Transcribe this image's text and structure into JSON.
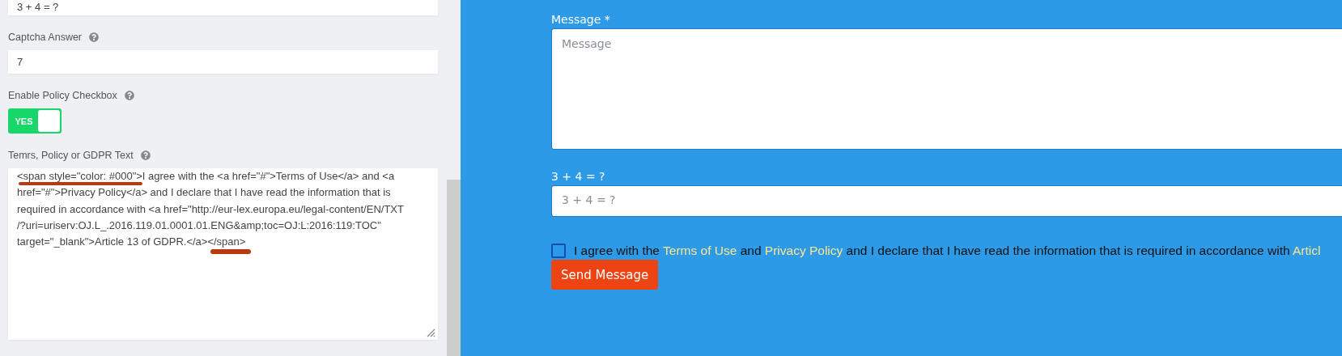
{
  "settings": {
    "fields": [
      {
        "kind": "input",
        "value": "3 + 4 = ?"
      },
      {
        "kind": "input",
        "label": "Captcha Answer",
        "value": "7"
      },
      {
        "kind": "toggle",
        "label": "Enable Policy Checkbox",
        "on": true,
        "toggle_text": "YES"
      },
      {
        "kind": "textarea",
        "label": "Temrs, Policy or GDPR Text",
        "value_lines": [
          "<span style=\"color: #000\">I agree with the <a href=\"#\">Terms of Use</a> and <a",
          "href=\"#\">Privacy Policy</a> and I declare that I have read the information that is",
          "required in accordance with <a href=\"http://eur-lex.europa.eu/legal-content/EN/TXT",
          "/?uri=uriserv:OJ.L_.2016.119.01.0001.01.ENG&amp;toc=OJ:L:2016:119:TOC\"",
          "target=\"_blank\">Article 13 of GDPR.</a></span>"
        ]
      }
    ]
  },
  "preview": {
    "message": {
      "label": "Message *",
      "placeholder": "Message"
    },
    "captcha": {
      "label": "3 + 4 = ?",
      "placeholder": "3 + 4 = ?"
    },
    "policy": {
      "checked": false,
      "segments": [
        {
          "kind": "text",
          "text": "I agree with the "
        },
        {
          "kind": "link",
          "text": "Terms of Use"
        },
        {
          "kind": "text",
          "text": " and "
        },
        {
          "kind": "link",
          "text": "Privacy Policy"
        },
        {
          "kind": "text",
          "text": " and I declare that I have read the information that is required in accordance with "
        },
        {
          "kind": "link",
          "text": "Articl"
        }
      ]
    },
    "submit": "Send Message"
  }
}
